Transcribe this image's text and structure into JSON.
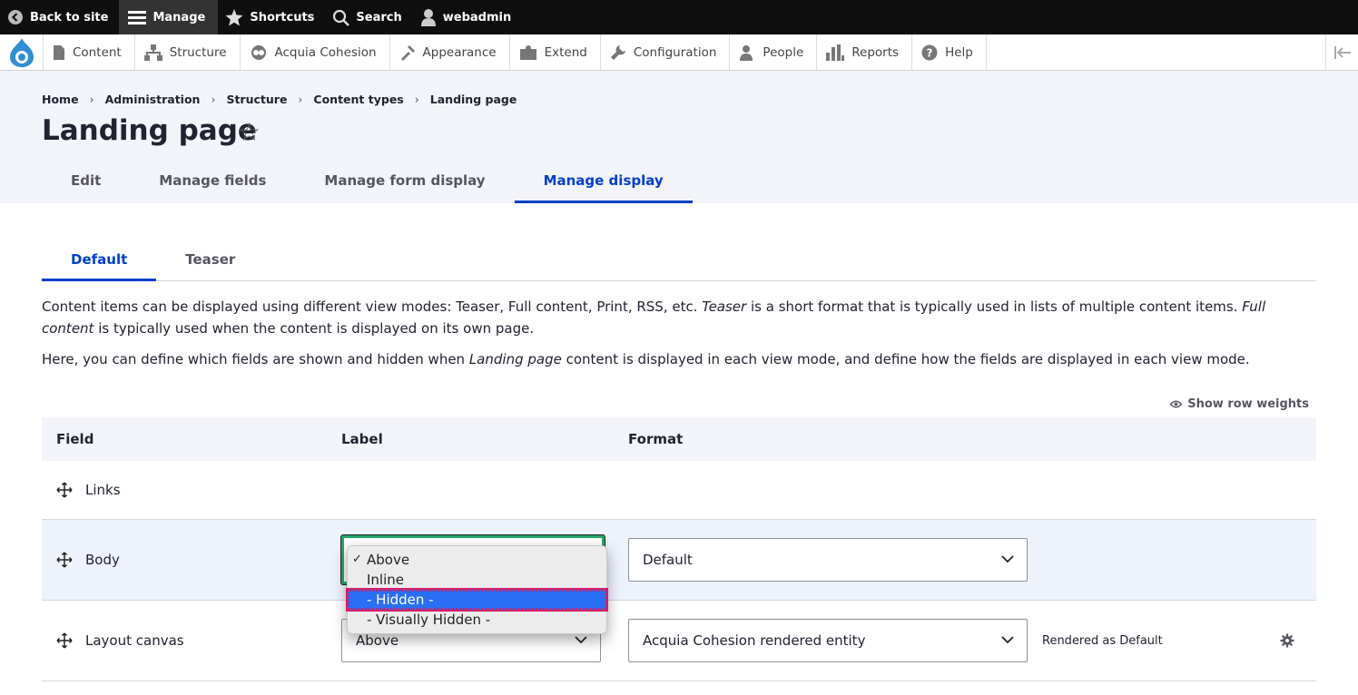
{
  "toolbar": {
    "back": "Back to site",
    "manage": "Manage",
    "shortcuts": "Shortcuts",
    "search": "Search",
    "user": "webadmin"
  },
  "tray": {
    "items": [
      "Content",
      "Structure",
      "Acquia Cohesion",
      "Appearance",
      "Extend",
      "Configuration",
      "People",
      "Reports",
      "Help"
    ]
  },
  "breadcrumb": [
    "Home",
    "Administration",
    "Structure",
    "Content types",
    "Landing page"
  ],
  "page_title": "Landing page",
  "primary_tabs": [
    "Edit",
    "Manage fields",
    "Manage form display",
    "Manage display"
  ],
  "secondary_tabs": [
    "Default",
    "Teaser"
  ],
  "description": {
    "p1_a": "Content items can be displayed using different view modes: Teaser, Full content, Print, RSS, etc. ",
    "p1_b": "Teaser",
    "p1_c": " is a short format that is typically used in lists of multiple content items. ",
    "p1_d": "Full content",
    "p1_e": " is typically used when the content is displayed on its own page.",
    "p2_a": "Here, you can define which fields are shown and hidden when ",
    "p2_b": "Landing page",
    "p2_c": " content is displayed in each view mode, and define how the fields are displayed in each view mode."
  },
  "show_row_weights": "Show row weights",
  "table": {
    "headers": {
      "field": "Field",
      "label": "Label",
      "format": "Format"
    },
    "rows": [
      {
        "field": "Links",
        "label": "",
        "format": "",
        "summary": ""
      },
      {
        "field": "Body",
        "label": "",
        "format": "Default",
        "summary": ""
      },
      {
        "field": "Layout canvas",
        "label": "Above",
        "format": "Acquia Cohesion rendered entity",
        "summary": "Rendered as Default"
      }
    ]
  },
  "dropdown": {
    "options": [
      "Above",
      "Inline",
      "- Hidden -",
      "- Visually Hidden -"
    ],
    "checked": "Above",
    "highlighted": "- Hidden -"
  },
  "colors": {
    "accent": "#003ecc",
    "focus": "#26a769",
    "highlight": "#2a6ef5"
  }
}
